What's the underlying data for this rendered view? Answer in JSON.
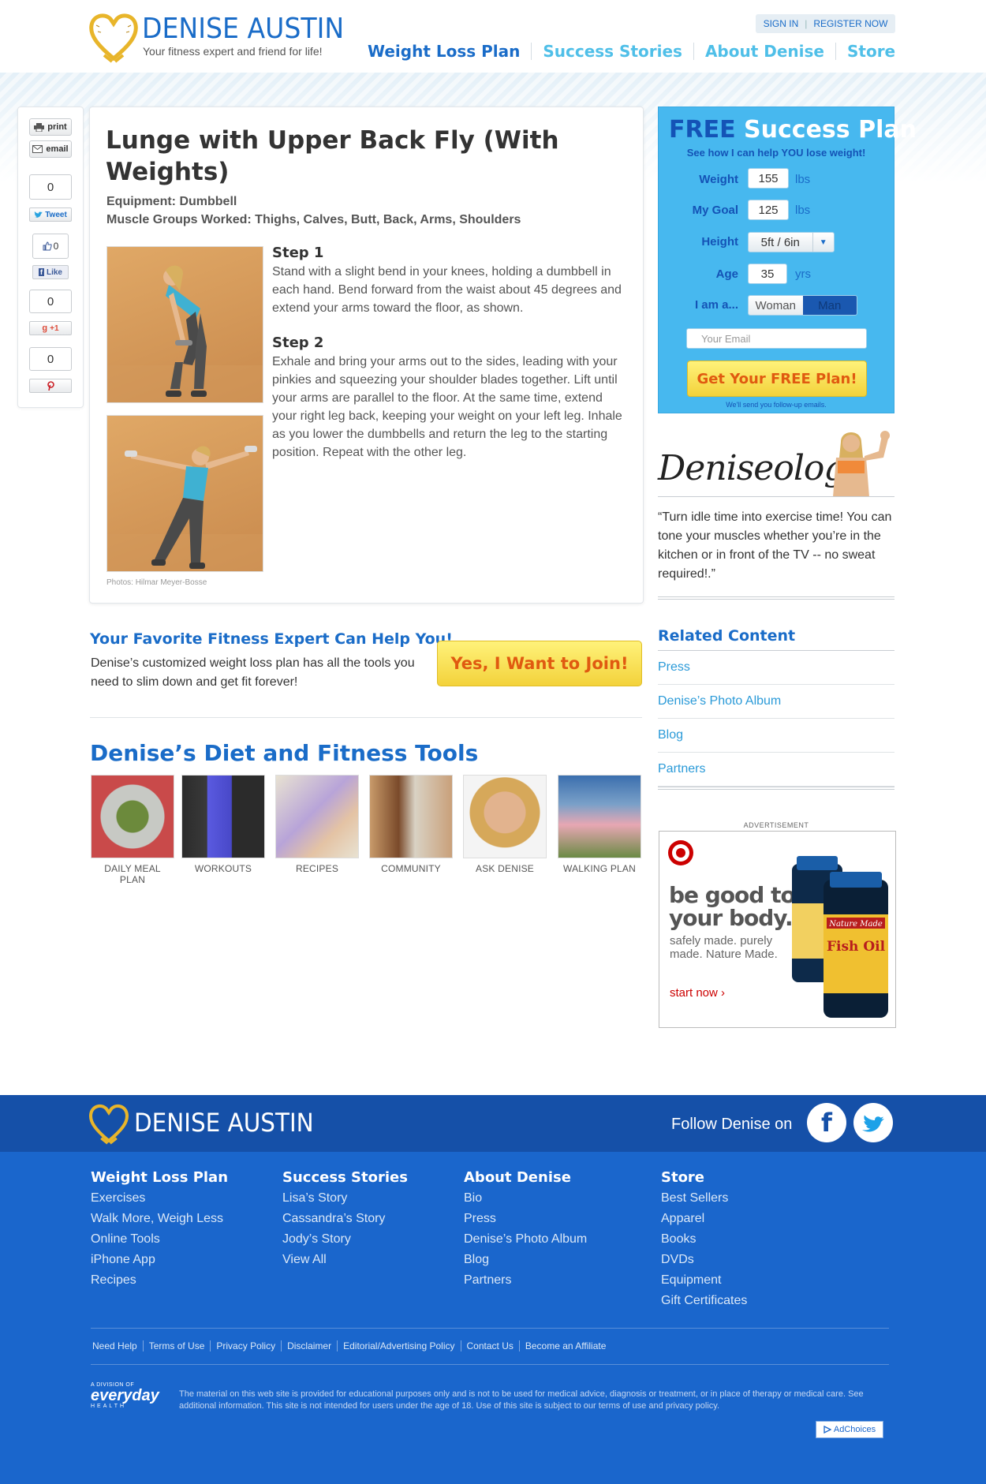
{
  "header": {
    "logo_name": "DENISE AUSTIN",
    "tagline": "Your fitness expert and friend for life!",
    "sign_in": "SIGN IN",
    "register": "REGISTER NOW",
    "nav": [
      "Weight Loss Plan",
      "Success Stories",
      "About Denise",
      "Store"
    ]
  },
  "share": {
    "print": "print",
    "email": "email",
    "tweet_count": "0",
    "tweet": "Tweet",
    "like_count": "0",
    "like": "Like",
    "gplus_count": "0",
    "gplus": "+1",
    "pin_count": "0"
  },
  "article": {
    "title": "Lunge with Upper Back Fly (With Weights)",
    "equipment": "Equipment: Dumbbell",
    "muscles": "Muscle Groups Worked: Thighs, Calves, Butt, Back, Arms, Shoulders",
    "step1_title": "Step 1",
    "step1_text": "Stand with a slight bend in your knees, holding a dumbbell in each hand. Bend forward from the waist about 45 degrees and extend your arms toward the floor, as shown.",
    "step2_title": "Step 2",
    "step2_text": "Exhale and bring your arms out to the sides, leading with your pinkies and squeezing your shoulder blades together. Lift until your arms are parallel to the floor. At the same time, extend your right leg back, keeping your weight on your left leg. Inhale as you lower the dumbbells and return the leg to the starting position. Repeat with the other leg.",
    "photo_credit": "Photos:  Hilmar Meyer-Bosse"
  },
  "promo": {
    "title": "Your Favorite Fitness Expert Can Help You!",
    "text": "Denise’s customized weight loss plan has all the tools you need to slim down and get fit forever!",
    "button": "Yes, I Want to Join!"
  },
  "tools": {
    "title": "Denise’s Diet and Fitness Tools",
    "items": [
      "DAILY MEAL PLAN",
      "WORKOUTS",
      "RECIPES",
      "COMMUNITY",
      "ASK DENISE",
      "WALKING PLAN"
    ]
  },
  "plan": {
    "title_free": "FREE",
    "title_rest": "Success Plan",
    "subtitle": "See how I can help YOU lose weight!",
    "weight_label": "Weight",
    "weight_value": "155",
    "weight_unit": "lbs",
    "goal_label": "My Goal",
    "goal_value": "125",
    "goal_unit": "lbs",
    "height_label": "Height",
    "height_value": "5ft / 6in",
    "age_label": "Age",
    "age_value": "35",
    "age_unit": "yrs",
    "gender_label": "I am a...",
    "gender_woman": "Woman",
    "gender_man": "Man",
    "email_placeholder": "Your Email",
    "button": "Get Your FREE Plan!",
    "note": "We'll send you follow-up emails."
  },
  "deniseology": {
    "word": "Deniseology",
    "quote": "“Turn idle time into exercise time! You can tone your muscles whether you’re in the kitchen or in front of the TV -- no sweat required!.”"
  },
  "related": {
    "title": "Related Content",
    "items": [
      "Press",
      "Denise’s Photo Album",
      "Blog",
      "Partners"
    ]
  },
  "ad": {
    "label": "ADVERTISEMENT",
    "headline": "be good to your body.",
    "sub": "safely made. purely made. Nature Made.",
    "cta": "start now ›",
    "brand": "Nature Made",
    "product": "Fish Oil"
  },
  "footer": {
    "logo_name": "DENISE AUSTIN",
    "follow": "Follow Denise on",
    "columns": [
      {
        "title": "Weight Loss Plan",
        "items": [
          "Exercises",
          "Walk More, Weigh Less",
          "Online Tools",
          "iPhone App",
          "Recipes"
        ]
      },
      {
        "title": "Success Stories",
        "items": [
          "Lisa’s Story",
          "Cassandra’s Story",
          "Jody’s Story",
          "View All"
        ]
      },
      {
        "title": "About Denise",
        "items": [
          "Bio",
          "Press",
          "Denise’s Photo Album",
          "Blog",
          "Partners"
        ]
      },
      {
        "title": "Store",
        "items": [
          "Best Sellers",
          "Apparel",
          "Books",
          "DVDs",
          "Equipment",
          "Gift Certificates"
        ]
      }
    ],
    "links": [
      "Need Help",
      "Terms of Use",
      "Privacy Policy",
      "Disclaimer",
      "Editorial/Advertising Policy",
      "Contact Us",
      "Become an Affiliate"
    ],
    "division_small": "A DIVISION OF",
    "division_big": "everyday",
    "division_health": "HEALTH",
    "disclaimer": "The material on this web site is provided for educational purposes only and is not to be used for medical advice, diagnosis or treatment, or in place of therapy or medical care. See additional information. This site is not intended for users under the age of 18. Use of this site is subject to our terms of use and privacy policy.",
    "adchoices": "AdChoices"
  },
  "colors": {
    "brand_blue": "#1a6cc8",
    "light_blue": "#4fbfe8",
    "plan_bg": "#47b8ef",
    "button_yellow": "#f3d23b",
    "button_text": "#e05a10",
    "footer_dark": "#1550a8",
    "footer_main": "#1a66cc"
  }
}
